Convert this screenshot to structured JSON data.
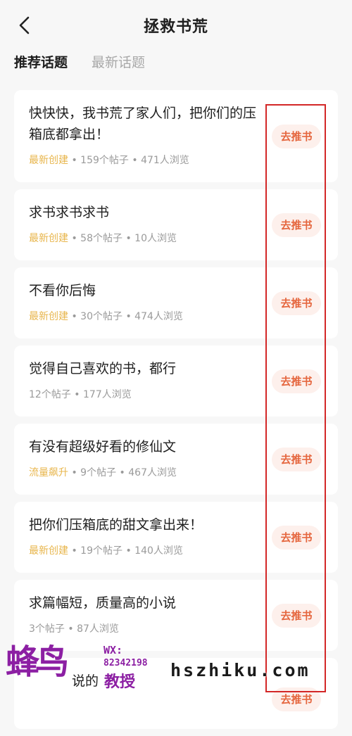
{
  "header": {
    "title": "拯救书荒",
    "back_icon": "chevron-left-icon"
  },
  "tabs": [
    {
      "label": "推荐话题",
      "active": true
    },
    {
      "label": "最新话题",
      "active": false
    }
  ],
  "topics": [
    {
      "title": "快快快，我书荒了家人们，把你们的压箱底都拿出！",
      "tag": "最新创建",
      "posts": "159个帖子",
      "views": "471人浏览",
      "button": "去推书"
    },
    {
      "title": "求书求书求书",
      "tag": "最新创建",
      "posts": "58个帖子",
      "views": "10人浏览",
      "button": "去推书"
    },
    {
      "title": "不看你后悔",
      "tag": "最新创建",
      "posts": "30个帖子",
      "views": "474人浏览",
      "button": "去推书"
    },
    {
      "title": "觉得自己喜欢的书，都行",
      "tag": "",
      "posts": "12个帖子",
      "views": "177人浏览",
      "button": "去推书"
    },
    {
      "title": "有没有超级好看的修仙文",
      "tag": "流量飙升",
      "posts": "9个帖子",
      "views": "467人浏览",
      "button": "去推书"
    },
    {
      "title": "把你们压箱底的甜文拿出来！",
      "tag": "最新创建",
      "posts": "19个帖子",
      "views": "140人浏览",
      "button": "去推书"
    },
    {
      "title": "求篇幅短，质量高的小说",
      "tag": "",
      "posts": "3个帖子",
      "views": "87人浏览",
      "button": "去推书"
    },
    {
      "title": "说的",
      "tag": "",
      "posts": "",
      "views": "",
      "button": "去推书"
    }
  ],
  "separator": " • ",
  "watermark": {
    "logo": "蜂鸟",
    "wx_label": "WX:",
    "wx_number": "82342198",
    "sub": "教授",
    "url": "hszhiku.com"
  },
  "colors": {
    "accent": "#e5663e",
    "tag": "#e8b64d",
    "highlight": "#d32727"
  }
}
